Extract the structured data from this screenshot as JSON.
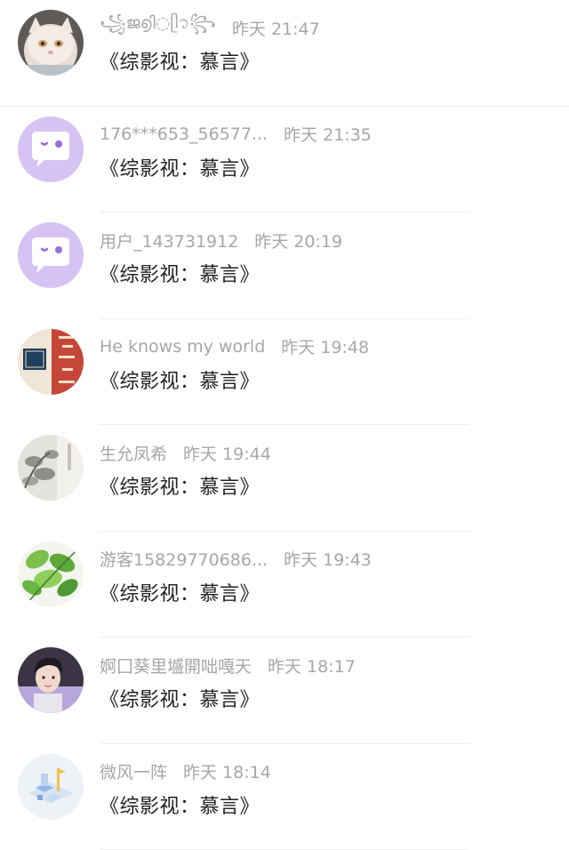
{
  "messages": [
    {
      "username": "꧁ജ൭ി◌ᥫ᭡꧂",
      "time": "昨天 21:47",
      "text": "《综影视：慕言》",
      "avatar_icon": "cat-avatar-icon"
    },
    {
      "username": "176***653_56577...",
      "time": "昨天 21:35",
      "text": "《综影视：慕言》",
      "avatar_icon": "chat-bubble-default-avatar-icon"
    },
    {
      "username": "用户_143731912",
      "time": "昨天 20:19",
      "text": "《综影视：慕言》",
      "avatar_icon": "chat-bubble-default-avatar-icon"
    },
    {
      "username": "He knows my world",
      "time": "昨天 19:48",
      "text": "《综影视：慕言》",
      "avatar_icon": "calligraphy-avatar-icon"
    },
    {
      "username": "生允凤希",
      "time": "昨天 19:44",
      "text": "《综影视：慕言》",
      "avatar_icon": "ink-painting-avatar-icon"
    },
    {
      "username": "游客15829770686...",
      "time": "昨天 19:43",
      "text": "《综影视：慕言》",
      "avatar_icon": "green-leaves-avatar-icon"
    },
    {
      "username": "婀囗葵里墭開咄嘎天",
      "time": "昨天 18:17",
      "text": "《综影视：慕言》",
      "avatar_icon": "portrait-avatar-icon"
    },
    {
      "username": "微风一阵",
      "time": "昨天 18:14",
      "text": "《综影视：慕言》",
      "avatar_icon": "isometric-illustration-avatar-icon"
    }
  ],
  "colors": {
    "meta": "#a7a7a7",
    "text": "#222222",
    "default_avatar_bg": "#d6c3f4",
    "default_avatar_fg": "#9b6bdc"
  }
}
